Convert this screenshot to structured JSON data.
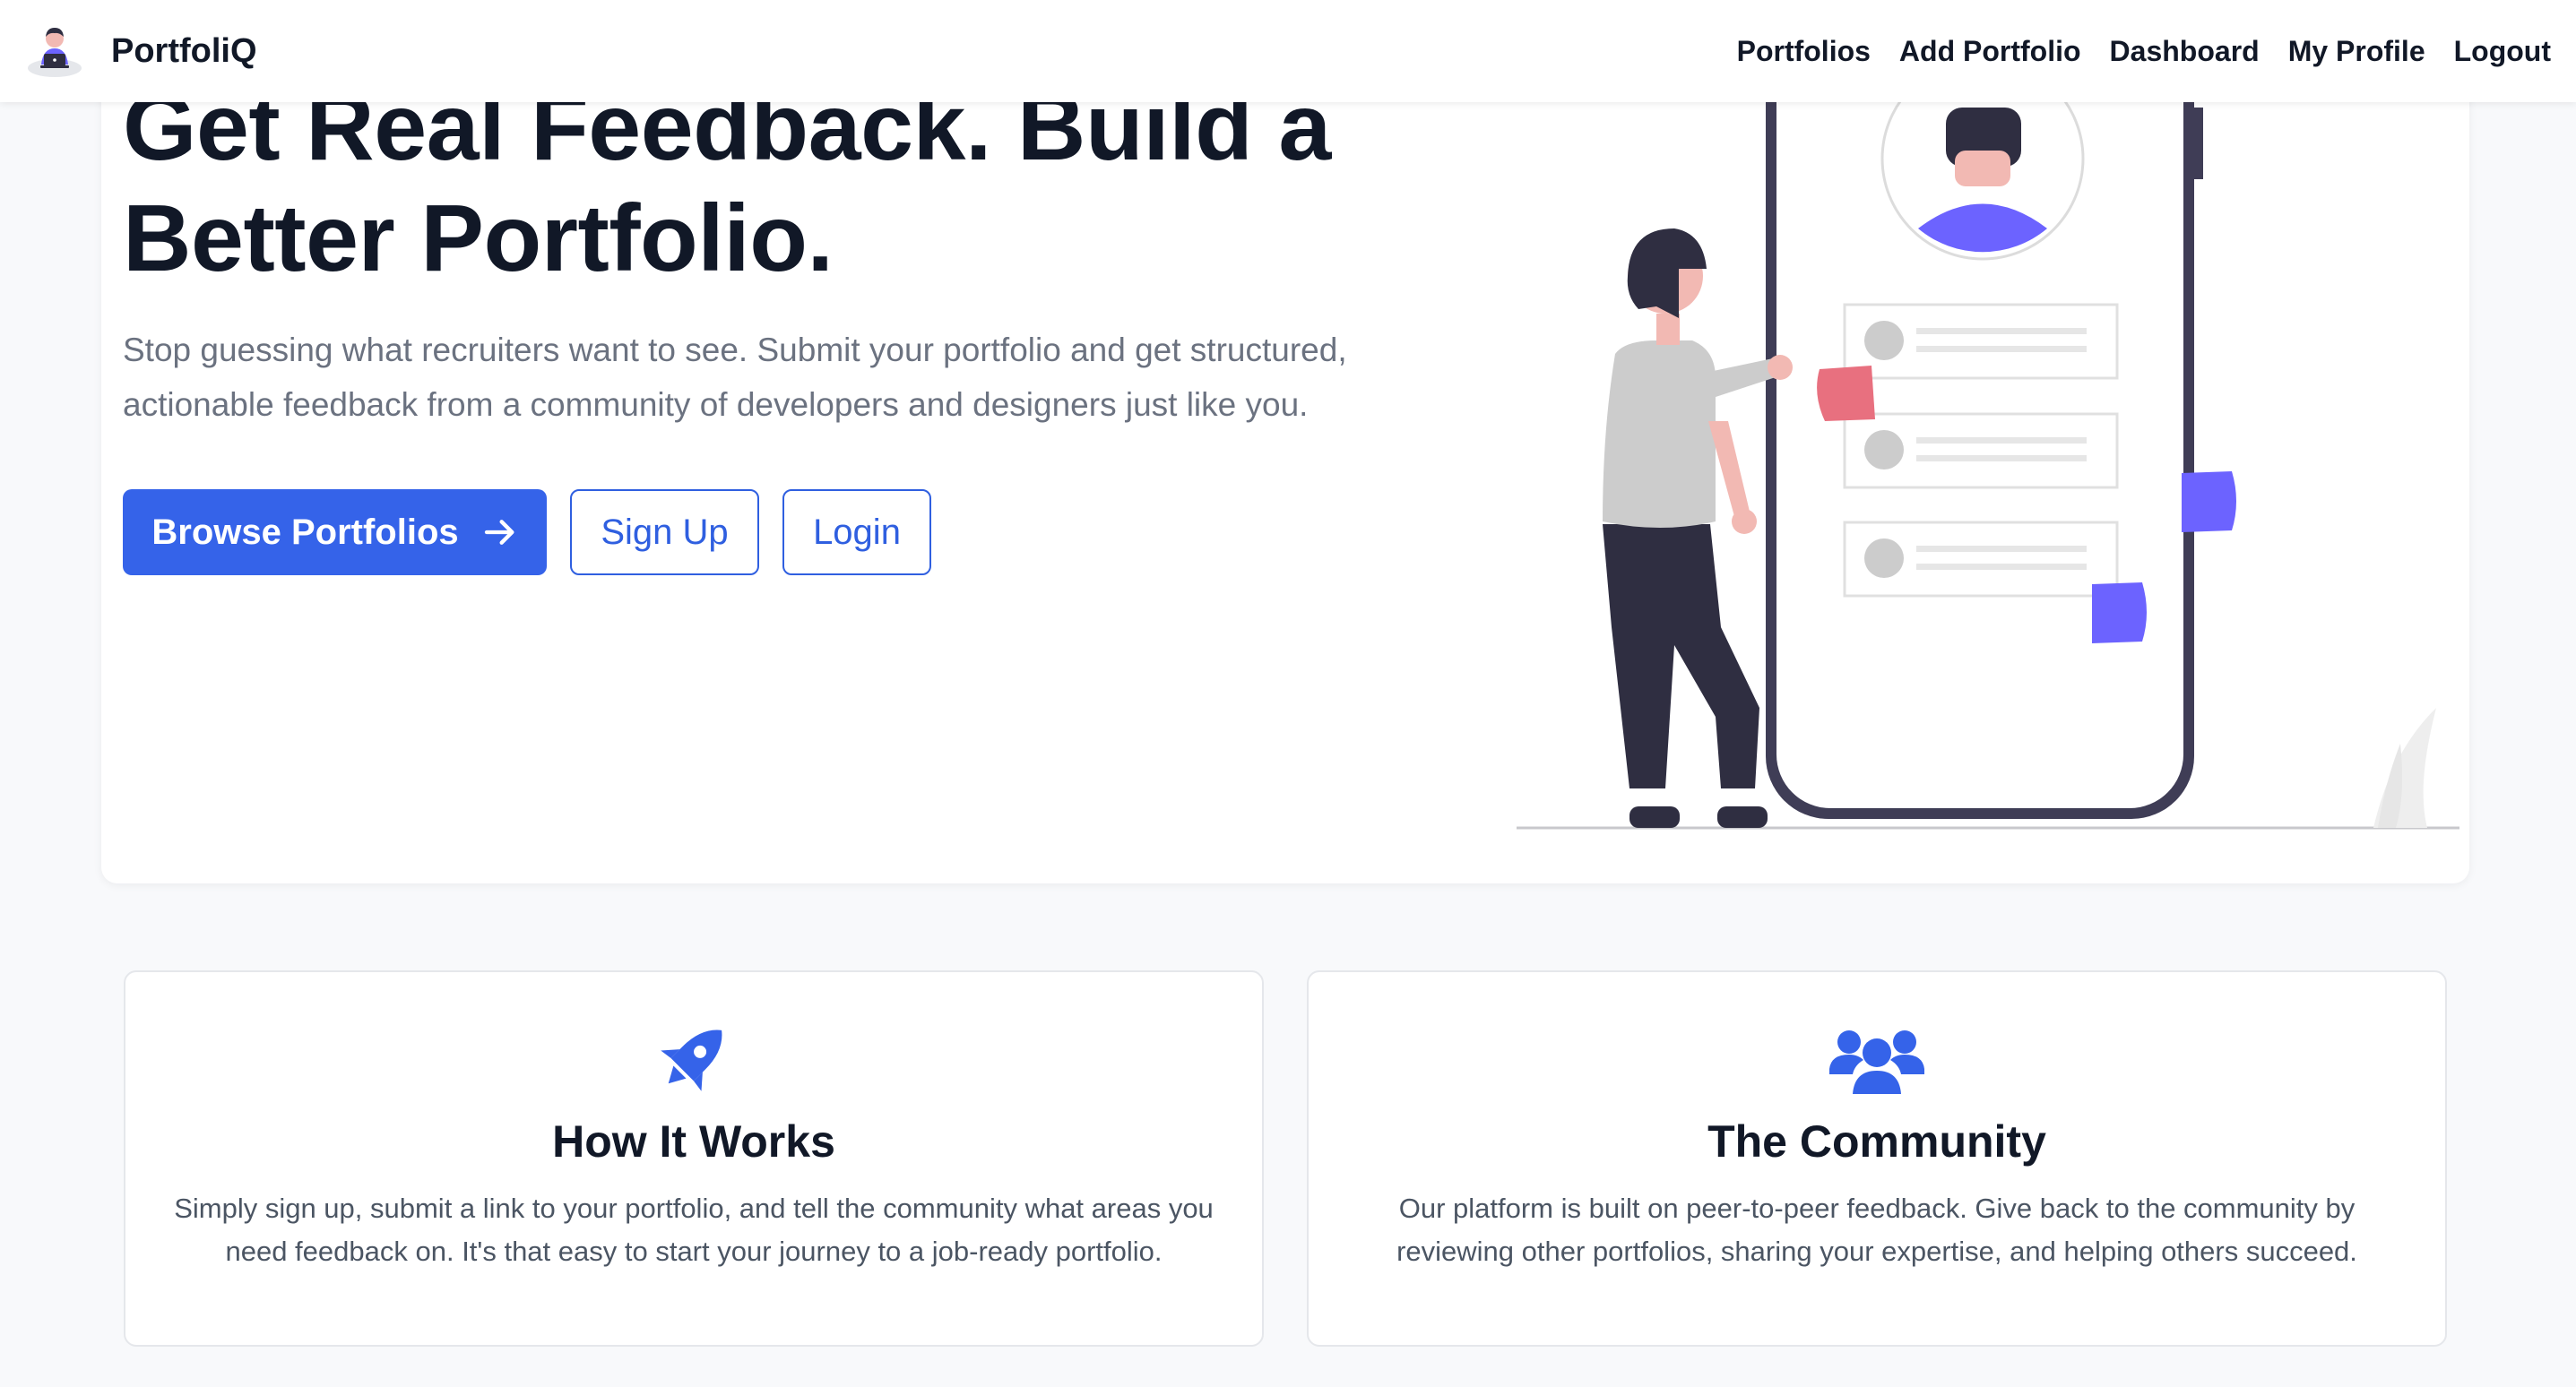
{
  "brand": {
    "name": "PortfoliQ",
    "logo_icon": "avatar-laptop-logo"
  },
  "nav": {
    "items": [
      {
        "label": "Portfolios"
      },
      {
        "label": "Add Portfolio"
      },
      {
        "label": "Dashboard"
      },
      {
        "label": "My Profile"
      },
      {
        "label": "Logout"
      }
    ]
  },
  "hero": {
    "title": "Get Real Feedback. Build a Better Portfolio.",
    "subtitle": "Stop guessing what recruiters want to see. Submit your portfolio and get structured, actionable feedback from a community of developers and designers just like you.",
    "buttons": {
      "browse": "Browse Portfolios",
      "signup": "Sign Up",
      "login": "Login"
    }
  },
  "features": [
    {
      "icon": "rocket-icon",
      "title": "How It Works",
      "text": "Simply sign up, submit a link to your portfolio, and tell the community what areas you need feedback on. It's that easy to start your journey to a job-ready portfolio."
    },
    {
      "icon": "users-icon",
      "title": "The Community",
      "text": "Our platform is built on peer-to-peer feedback. Give back to the community by reviewing other portfolios, sharing your expertise, and helping others succeed."
    }
  ],
  "colors": {
    "primary": "#3563e9",
    "accent_purple": "#6c63ff",
    "accent_pink": "#e8707f",
    "text_dark": "#111827",
    "text_muted": "#6b7280",
    "page_bg": "#f8f9fb"
  }
}
